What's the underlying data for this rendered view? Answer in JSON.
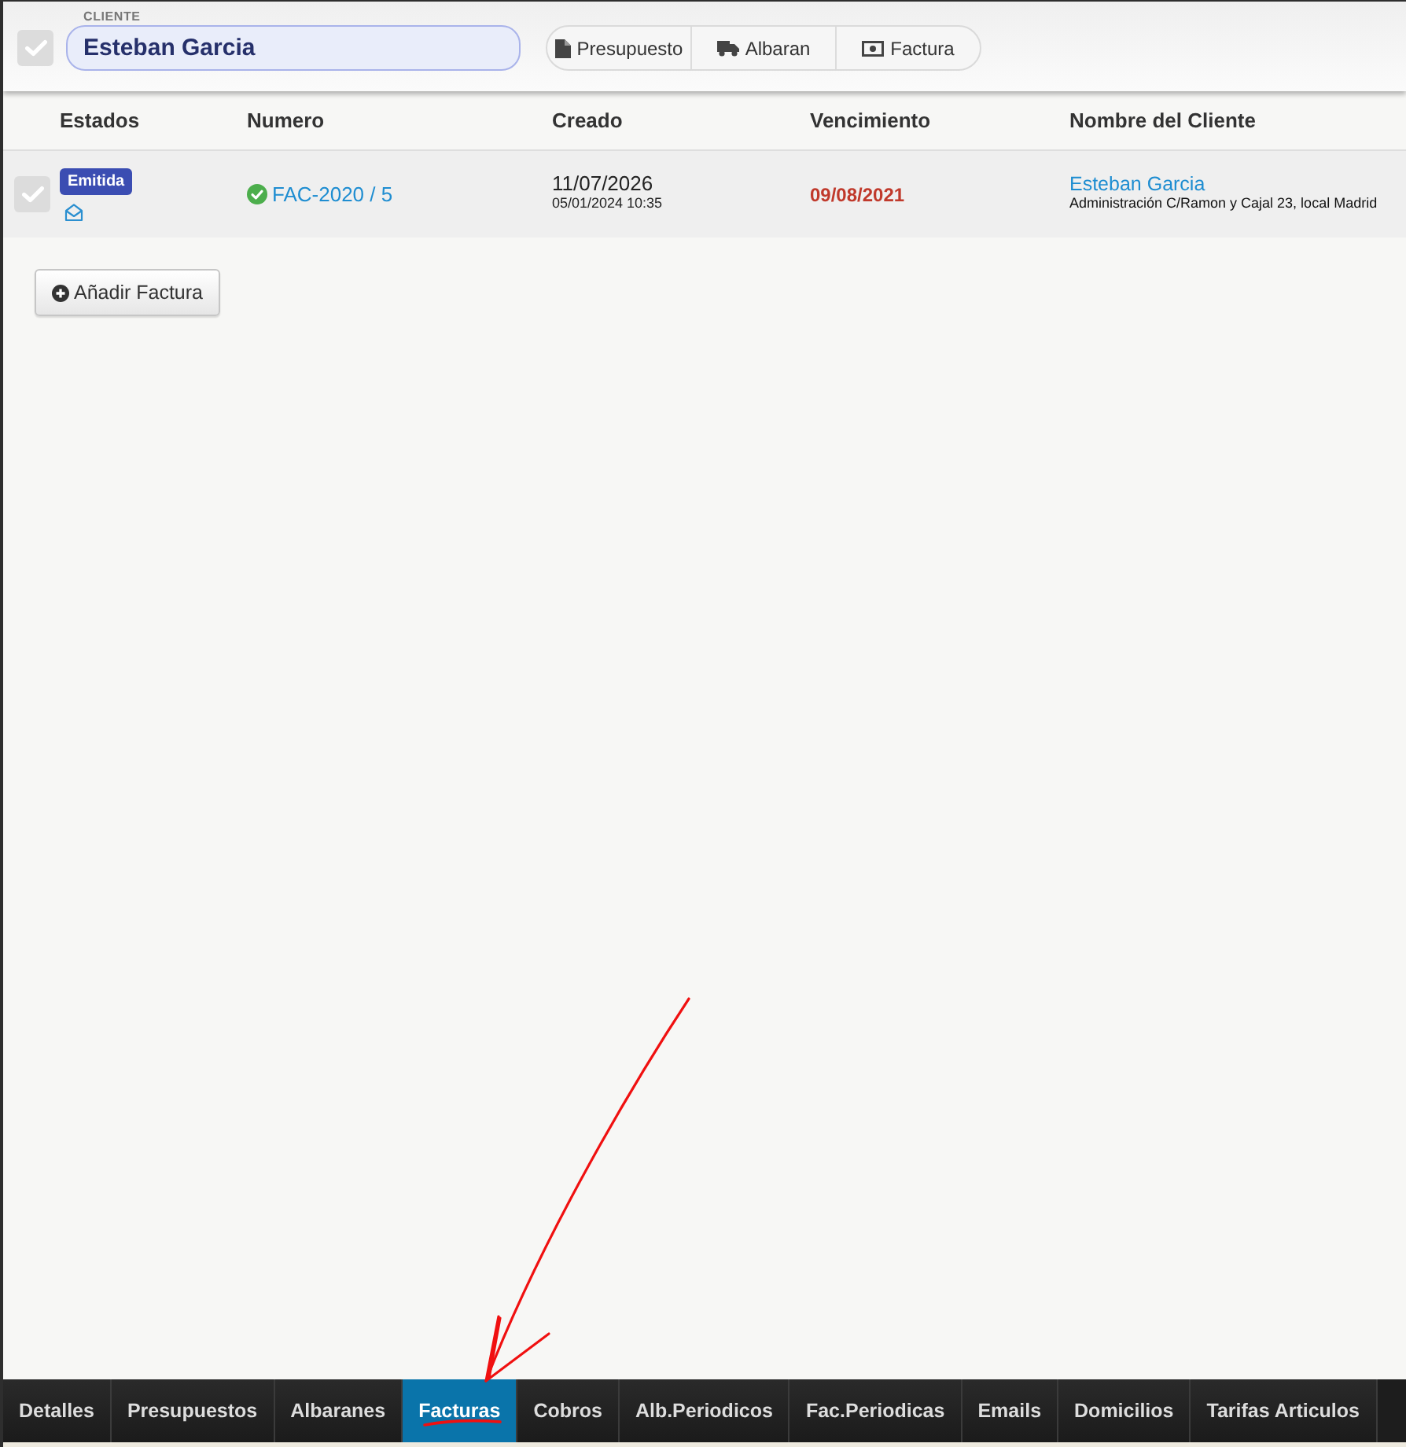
{
  "client_field": {
    "checked": false,
    "label": "CLIENTE",
    "value": "Esteban Garcia"
  },
  "doc_buttons": [
    {
      "kind": "file",
      "label": "Presupuesto"
    },
    {
      "kind": "truck",
      "label": "Albaran"
    },
    {
      "kind": "money",
      "label": "Factura"
    }
  ],
  "table": {
    "columns": [
      "Estados",
      "Numero",
      "Creado",
      "Vencimiento",
      "Nombre del Cliente"
    ],
    "rows": [
      {
        "checked": false,
        "status": "Emitida",
        "emailed": true,
        "confirmed": true,
        "number": "FAC-2020 / 5",
        "created": "11/07/2026",
        "created_detail": "05/01/2024 10:35",
        "due": "09/08/2021",
        "overdue": true,
        "client": "Esteban Garcia",
        "address": "Administración C/Ramon y Cajal 23, local Madrid"
      }
    ]
  },
  "add_button": {
    "label": "Añadir Factura"
  },
  "tabs": [
    {
      "label": "Detalles",
      "selected": false
    },
    {
      "label": "Presupuestos",
      "selected": false
    },
    {
      "label": "Albaranes",
      "selected": false
    },
    {
      "label": "Facturas",
      "selected": true
    },
    {
      "label": "Cobros",
      "selected": false
    },
    {
      "label": "Alb.Periodicos",
      "selected": false
    },
    {
      "label": "Fac.Periodicas",
      "selected": false
    },
    {
      "label": "Emails",
      "selected": false
    },
    {
      "label": "Domicilios",
      "selected": false
    },
    {
      "label": "Tarifas Articulos",
      "selected": false
    }
  ],
  "annotation": {
    "arrow": true,
    "underline": true
  }
}
